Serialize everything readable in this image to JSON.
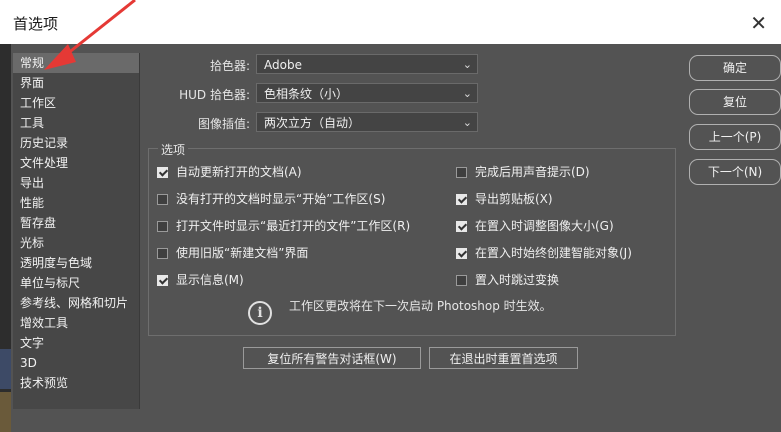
{
  "window": {
    "title": "首选项",
    "close_glyph": "✕"
  },
  "sidebar": {
    "items": [
      "常规",
      "界面",
      "工作区",
      "工具",
      "历史记录",
      "文件处理",
      "导出",
      "性能",
      "暂存盘",
      "光标",
      "透明度与色域",
      "单位与标尺",
      "参考线、网格和切片",
      "增效工具",
      "文字",
      "3D",
      "技术预览"
    ],
    "active_index": 0
  },
  "general": {
    "color_picker": {
      "label": "拾色器:",
      "value": "Adobe"
    },
    "hud_color_picker": {
      "label": "HUD 拾色器:",
      "value": "色相条纹（小）"
    },
    "image_interpolation": {
      "label": "图像插值:",
      "value": "两次立方（自动）"
    }
  },
  "options": {
    "title": "选项",
    "left": [
      {
        "label": "自动更新打开的文档(A)",
        "checked": true
      },
      {
        "label": "没有打开的文档时显示“开始”工作区(S)",
        "checked": false
      },
      {
        "label": "打开文件时显示“最近打开的文件”工作区(R)",
        "checked": false
      },
      {
        "label": "使用旧版“新建文档”界面",
        "checked": false
      },
      {
        "label": "显示信息(M)",
        "checked": true
      }
    ],
    "right": [
      {
        "label": "完成后用声音提示(D)",
        "checked": false
      },
      {
        "label": "导出剪贴板(X)",
        "checked": true
      },
      {
        "label": "在置入时调整图像大小(G)",
        "checked": true
      },
      {
        "label": "在置入时始终创建智能对象(J)",
        "checked": true
      },
      {
        "label": "置入时跳过变换",
        "checked": false
      }
    ],
    "info_message": "工作区更改将在下一次启动 Photoshop 时生效。"
  },
  "bottom_buttons": {
    "reset_warnings": "复位所有警告对话框(W)",
    "reset_on_quit": "在退出时重置首选项"
  },
  "right_buttons": {
    "ok": "确定",
    "reset": "复位",
    "prev": "上一个(P)",
    "next": "下一个(N)"
  },
  "icons": {
    "info": "i",
    "chevron": "⌄"
  }
}
